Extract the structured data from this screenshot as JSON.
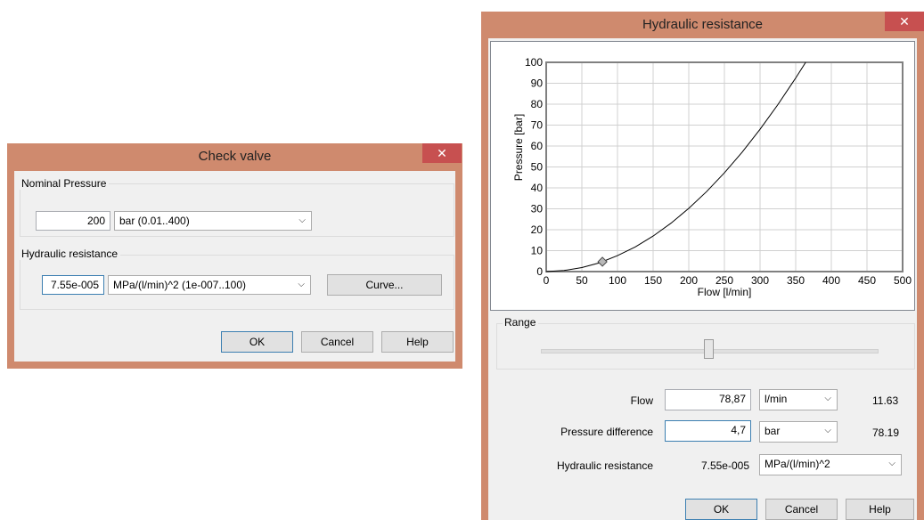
{
  "check_valve": {
    "title": "Check valve",
    "nominal_pressure": {
      "group_label": "Nominal Pressure",
      "value": "200",
      "unit": "bar  (0.01..400)"
    },
    "hydraulic_resistance": {
      "group_label": "Hydraulic resistance",
      "value": "7.55e-005",
      "unit": "MPa/(l/min)^2  (1e-007..100)",
      "curve_label": "Curve..."
    },
    "buttons": {
      "ok": "OK",
      "cancel": "Cancel",
      "help": "Help"
    }
  },
  "hydraulic_dialog": {
    "title": "Hydraulic resistance",
    "range_label": "Range",
    "range_position": 0.5,
    "fields": {
      "flow": {
        "label": "Flow",
        "value": "78,87",
        "unit": "l/min",
        "readout": "11.63"
      },
      "pressure": {
        "label": "Pressure difference",
        "value": "4,7",
        "unit": "bar",
        "readout": "78.19"
      },
      "resistance": {
        "label": "Hydraulic resistance",
        "value": "7.55e-005",
        "unit": "MPa/(l/min)^2"
      }
    },
    "buttons": {
      "ok": "OK",
      "cancel": "Cancel",
      "help": "Help"
    }
  },
  "chart_data": {
    "type": "line",
    "title": "",
    "xlabel": "Flow [l/min]",
    "ylabel": "Pressure [bar]",
    "xlim": [
      0,
      500
    ],
    "ylim": [
      0,
      100
    ],
    "x_ticks": [
      0,
      50,
      100,
      150,
      200,
      250,
      300,
      350,
      400,
      450,
      500
    ],
    "y_ticks": [
      0,
      10,
      20,
      30,
      40,
      50,
      60,
      70,
      80,
      90,
      100
    ],
    "grid": true,
    "series": [
      {
        "x": [
          0,
          25,
          50,
          75,
          100,
          125,
          150,
          175,
          200,
          225,
          250,
          275,
          300,
          325,
          350,
          364
        ],
        "y": [
          0,
          0.5,
          1.9,
          4.2,
          7.6,
          11.8,
          17.0,
          23.1,
          30.2,
          38.2,
          47.2,
          57.1,
          68.0,
          79.8,
          92.5,
          100
        ]
      }
    ],
    "marker": {
      "x": 78.87,
      "y": 4.7
    }
  },
  "colors": {
    "titlebar": "#cf8a6e",
    "close": "#c75050",
    "client": "#f0f0f0",
    "focus": "#3c7fb1"
  }
}
